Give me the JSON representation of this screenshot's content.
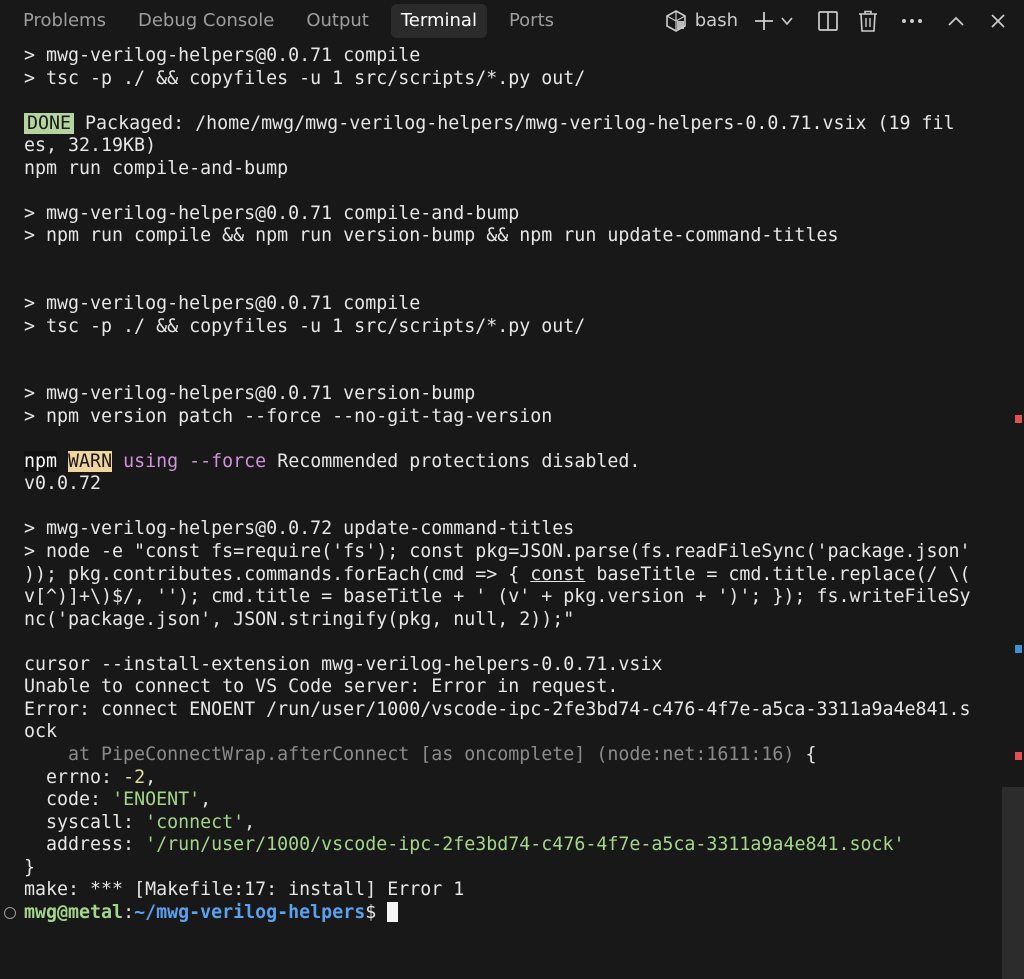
{
  "panel": {
    "tabs": [
      {
        "label": "Problems",
        "active": false
      },
      {
        "label": "Debug Console",
        "active": false
      },
      {
        "label": "Output",
        "active": false
      },
      {
        "label": "Terminal",
        "active": true
      },
      {
        "label": "Ports",
        "active": false
      }
    ],
    "shell": {
      "label": "bash",
      "icon": "terminal-bash-icon"
    },
    "actions": [
      "add-icon",
      "chevron-down-icon",
      "split-terminal-icon",
      "trash-icon",
      "more-icon",
      "chevron-up-icon",
      "close-icon"
    ]
  },
  "terminal": {
    "l1": "> mwg-verilog-helpers@0.0.71 compile",
    "l2": "> tsc -p ./ && copyfiles -u 1 src/scripts/*.py out/",
    "done": "DONE",
    "l4a": "Packaged: /home/mwg/mwg-verilog-helpers/mwg-verilog-helpers-0.0.71.vsix (19 fil",
    "l5": "es, 32.19KB)",
    "l6": "npm run compile-and-bump",
    "l8": "> mwg-verilog-helpers@0.0.71 compile-and-bump",
    "l9": "> npm run compile && npm run version-bump && npm run update-command-titles",
    "l12": "> mwg-verilog-helpers@0.0.71 compile",
    "l13": "> tsc -p ./ && copyfiles -u 1 src/scripts/*.py out/",
    "l16": "> mwg-verilog-helpers@0.0.71 version-bump",
    "l17": "> npm version patch --force --no-git-tag-version",
    "npm": "npm",
    "warn": "WARN",
    "using_force": "using --force",
    "l19rest": "Recommended protections disabled.",
    "l20": "v0.0.72",
    "l22": "> mwg-verilog-helpers@0.0.72 update-command-titles",
    "l23": "> node -e \"const fs=require('fs'); const pkg=JSON.parse(fs.readFileSync('package.json'",
    "l24a": ")); pkg.contributes.commands.forEach(cmd => { ",
    "l24const": "const",
    "l24b": " baseTitle = cmd.title.replace(/ \\(",
    "l25": "v[^)]+\\)$/, ''); cmd.title = baseTitle + ' (v' + pkg.version + ')'; }); fs.writeFileSy",
    "l26": "nc('package.json', JSON.stringify(pkg, null, 2));\"",
    "l28": "cursor --install-extension mwg-verilog-helpers-0.0.71.vsix",
    "l29": "Unable to connect to VS Code server: Error in request.",
    "l30": "Error: connect ENOENT /run/user/1000/vscode-ipc-2fe3bd74-c476-4f7e-a5ca-3311a9a4e841.s",
    "l31": "ock",
    "l32dim": "    at PipeConnectWrap.afterConnect [as oncomplete] (node:net:1611:16)",
    "l32brace": " {",
    "errno_key": "  errno: ",
    "errno_val": "-2",
    "errno_end": ",",
    "code_key": "  code: ",
    "code_val": "'ENOENT'",
    "code_end": ",",
    "syscall_key": "  syscall: ",
    "syscall_val": "'connect'",
    "syscall_end": ",",
    "address_key": "  address: ",
    "address_val": "'/run/user/1000/vscode-ipc-2fe3bd74-c476-4f7e-a5ca-3311a9a4e841.sock'",
    "close_brace": "}",
    "l38": "make: *** [Makefile:17: install] Error 1",
    "prompt_user": "mwg@metal",
    "prompt_sep": ":",
    "prompt_path": "~/mwg-verilog-helpers",
    "prompt_dollar": "$ "
  },
  "colors": {
    "background": "#181818",
    "done_badge": "#b5d4a0",
    "warn_badge": "#f1d5a1",
    "magenta": "#d092d8",
    "string": "#a3d68a",
    "number": "#e6d99b",
    "prompt_path": "#5aa2f0",
    "marker_red": "#e05252",
    "marker_blue": "#3d8fd6"
  }
}
